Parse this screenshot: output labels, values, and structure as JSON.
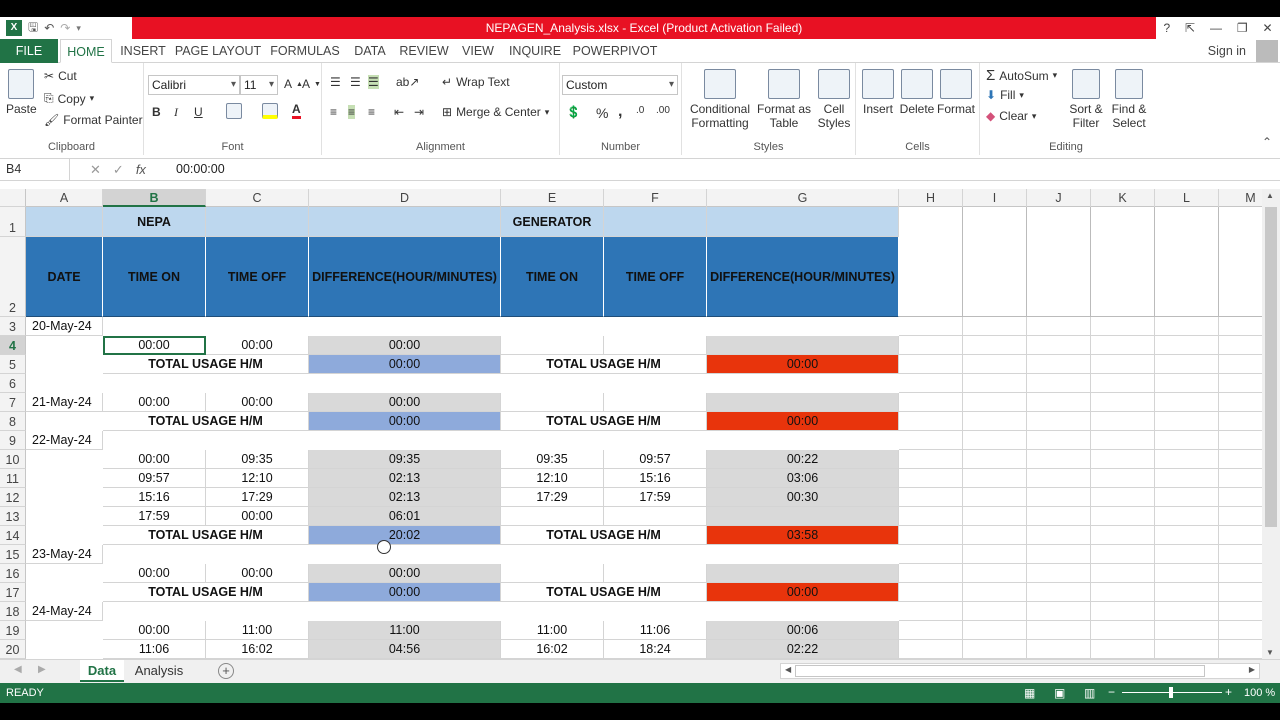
{
  "window": {
    "title": "NEPAGEN_Analysis.xlsx -  Excel (Product Activation Failed)",
    "help": "?"
  },
  "tabs": [
    "FILE",
    "HOME",
    "INSERT",
    "PAGE LAYOUT",
    "FORMULAS",
    "DATA",
    "REVIEW",
    "VIEW",
    "INQUIRE",
    "POWERPIVOT"
  ],
  "sign_in": "Sign in",
  "ribbon": {
    "clipboard": {
      "paste": "Paste",
      "cut": "Cut",
      "copy": "Copy",
      "format_painter": "Format Painter",
      "label": "Clipboard"
    },
    "font": {
      "name": "Calibri",
      "size": "11",
      "bold": "B",
      "italic": "I",
      "underline": "U",
      "label": "Font"
    },
    "alignment": {
      "wrap": "Wrap Text",
      "merge": "Merge & Center",
      "label": "Alignment"
    },
    "number": {
      "format": "Custom",
      "percent": "%",
      "comma": ",",
      "label": "Number"
    },
    "styles": {
      "cond": "Conditional Formatting",
      "table": "Format as Table",
      "cell": "Cell Styles",
      "label": "Styles"
    },
    "cells": {
      "insert": "Insert",
      "delete": "Delete",
      "format": "Format",
      "label": "Cells"
    },
    "editing": {
      "autosum": "AutoSum",
      "fill": "Fill",
      "clear": "Clear",
      "sort": "Sort & Filter",
      "find": "Find & Select",
      "label": "Editing"
    }
  },
  "formula_bar": {
    "name_box": "B4",
    "value": "00:00:00",
    "fx": "fx"
  },
  "columns": [
    "A",
    "B",
    "C",
    "D",
    "E",
    "F",
    "G",
    "H",
    "I",
    "J",
    "K",
    "L",
    "M"
  ],
  "rows": [
    "1",
    "2",
    "3",
    "4",
    "5",
    "6",
    "7",
    "8",
    "9",
    "10",
    "11",
    "12",
    "13",
    "14",
    "15",
    "16",
    "17",
    "18",
    "19",
    "20"
  ],
  "headers": {
    "nepa": "NEPA",
    "generator": "GENERATOR",
    "date": "DATE",
    "time_on": "TIME ON",
    "time_off": "TIME OFF",
    "difference": "DIFFERENCE(HOUR/MINUTES)",
    "total": "TOTAL USAGE H/M"
  },
  "data": {
    "d3": "20-May-24",
    "d7": "21-May-24",
    "d9": "22-May-24",
    "d15": "23-May-24",
    "d18": "24-May-24",
    "r4": [
      "00:00",
      "00:00",
      "00:00"
    ],
    "r5": [
      "00:00",
      "00:00"
    ],
    "r7": [
      "00:00",
      "00:00",
      "00:00"
    ],
    "r8": [
      "00:00",
      "00:00"
    ],
    "r10": [
      "00:00",
      "09:35",
      "09:35",
      "09:35",
      "09:57",
      "00:22"
    ],
    "r11": [
      "09:57",
      "12:10",
      "02:13",
      "12:10",
      "15:16",
      "03:06"
    ],
    "r12": [
      "15:16",
      "17:29",
      "02:13",
      "17:29",
      "17:59",
      "00:30"
    ],
    "r13": [
      "17:59",
      "00:00",
      "06:01"
    ],
    "r14": [
      "20:02",
      "03:58"
    ],
    "r16": [
      "00:00",
      "00:00",
      "00:00"
    ],
    "r17": [
      "00:00",
      "00:00"
    ],
    "r19": [
      "00:00",
      "11:00",
      "11:00",
      "11:00",
      "11:06",
      "00:06"
    ],
    "r20": [
      "11:06",
      "16:02",
      "04:56",
      "16:02",
      "18:24",
      "02:22"
    ]
  },
  "sheets": [
    "Data",
    "Analysis"
  ],
  "status": {
    "ready": "READY",
    "zoom": "100 %"
  },
  "colors": {
    "excel_green": "#217346",
    "title_red": "#e81123",
    "header_blue": "#2e75b6",
    "light_blue": "#bdd7ee",
    "total_blue": "#8eaadb",
    "total_red": "#e8340c"
  }
}
